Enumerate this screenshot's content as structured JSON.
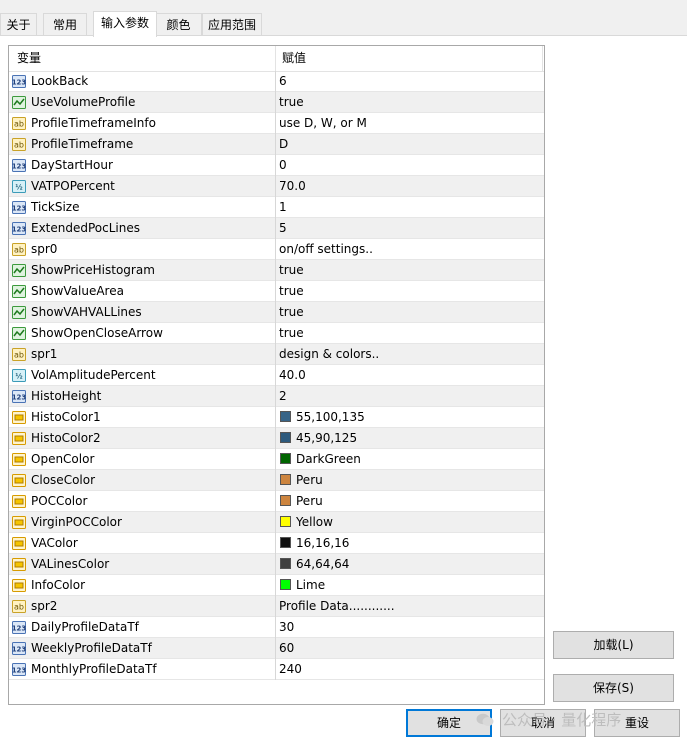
{
  "tabs": [
    {
      "label": "关于"
    },
    {
      "label": "常用"
    },
    {
      "label": "输入参数"
    },
    {
      "label": "颜色"
    },
    {
      "label": "应用范围"
    }
  ],
  "grid": {
    "header": {
      "variable": "变量",
      "value": "赋值"
    },
    "rows": [
      {
        "name": "LookBack",
        "value": "6",
        "type": "int"
      },
      {
        "name": "UseVolumeProfile",
        "value": "true",
        "type": "bool"
      },
      {
        "name": "ProfileTimeframeInfo",
        "value": "use D, W, or M",
        "type": "string"
      },
      {
        "name": "ProfileTimeframe",
        "value": "D",
        "type": "string"
      },
      {
        "name": "DayStartHour",
        "value": "0",
        "type": "int"
      },
      {
        "name": "VATPOPercent",
        "value": "70.0",
        "type": "double"
      },
      {
        "name": "TickSize",
        "value": "1",
        "type": "int"
      },
      {
        "name": "ExtendedPocLines",
        "value": "5",
        "type": "int"
      },
      {
        "name": "spr0",
        "value": "on/off settings..",
        "type": "string"
      },
      {
        "name": "ShowPriceHistogram",
        "value": "true",
        "type": "bool"
      },
      {
        "name": "ShowValueArea",
        "value": "true",
        "type": "bool"
      },
      {
        "name": "ShowVAHVALLines",
        "value": "true",
        "type": "bool"
      },
      {
        "name": "ShowOpenCloseArrow",
        "value": "true",
        "type": "bool"
      },
      {
        "name": "spr1",
        "value": "design & colors..",
        "type": "string"
      },
      {
        "name": "VolAmplitudePercent",
        "value": "40.0",
        "type": "double"
      },
      {
        "name": "HistoHeight",
        "value": "2",
        "type": "int"
      },
      {
        "name": "HistoColor1",
        "value": "55,100,135",
        "type": "color",
        "swatch": "#376487"
      },
      {
        "name": "HistoColor2",
        "value": "45,90,125",
        "type": "color",
        "swatch": "#2d5a7d"
      },
      {
        "name": "OpenColor",
        "value": "DarkGreen",
        "type": "color",
        "swatch": "#006400"
      },
      {
        "name": "CloseColor",
        "value": "Peru",
        "type": "color",
        "swatch": "#cd853f"
      },
      {
        "name": "POCColor",
        "value": "Peru",
        "type": "color",
        "swatch": "#cd853f"
      },
      {
        "name": "VirginPOCColor",
        "value": "Yellow",
        "type": "color",
        "swatch": "#ffff00"
      },
      {
        "name": "VAColor",
        "value": "16,16,16",
        "type": "color",
        "swatch": "#101010"
      },
      {
        "name": "VALinesColor",
        "value": "64,64,64",
        "type": "color",
        "swatch": "#404040"
      },
      {
        "name": "InfoColor",
        "value": "Lime",
        "type": "color",
        "swatch": "#00ff00"
      },
      {
        "name": "spr2",
        "value": "Profile Data............",
        "type": "string"
      },
      {
        "name": "DailyProfileDataTf",
        "value": "30",
        "type": "int"
      },
      {
        "name": "WeeklyProfileDataTf",
        "value": "60",
        "type": "int"
      },
      {
        "name": "MonthlyProfileDataTf",
        "value": "240",
        "type": "int"
      }
    ]
  },
  "buttons": {
    "load": "加载(L)",
    "save": "保存(S)",
    "ok": "确定",
    "cancel": "取消",
    "reset": "重设"
  },
  "watermark": "公众号 · 量化程序"
}
